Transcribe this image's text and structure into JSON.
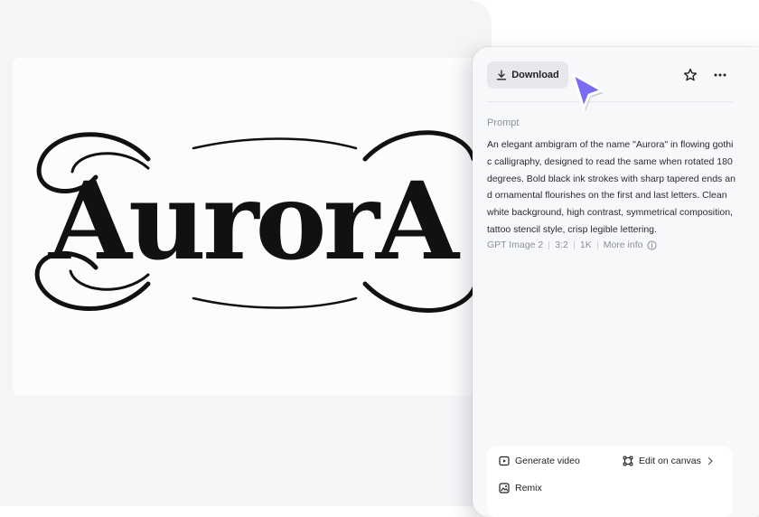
{
  "image": {
    "artwork_text": "AurorA"
  },
  "toolbar": {
    "download_label": "Download"
  },
  "prompt": {
    "label": "Prompt",
    "text": "An elegant ambigram of the name \"Aurora\" in flowing gothic calligraphy, designed to read the same when rotated 180 degrees. Bold black ink strokes with sharp tapered ends and ornamental flourishes on the first and last letters. Clean white background, high contrast, symmetrical composition, tattoo stencil style, crisp legible lettering."
  },
  "meta": {
    "model": "GPT Image 2",
    "ratio": "3:2",
    "resolution": "1K",
    "more_info": "More info"
  },
  "actions": {
    "generate_video": "Generate video",
    "edit_on_canvas": "Edit on canvas",
    "remix": "Remix"
  },
  "colors": {
    "cursor": "#7b6cf6",
    "panel_bg": "#f7f8fa"
  }
}
